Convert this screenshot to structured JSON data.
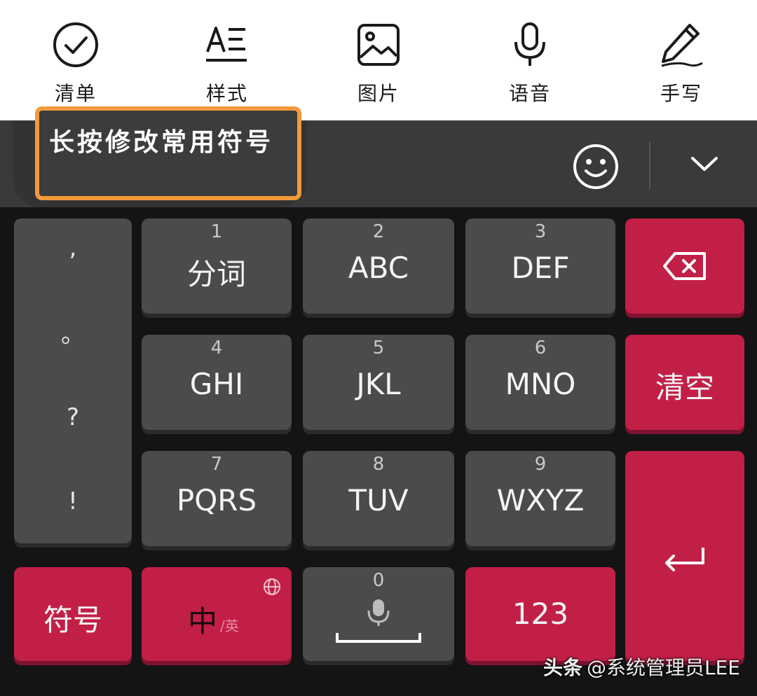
{
  "toolbar": {
    "items": [
      {
        "label": "清单",
        "icon": "checklist-circle-icon"
      },
      {
        "label": "样式",
        "icon": "text-style-icon"
      },
      {
        "label": "图片",
        "icon": "image-icon"
      },
      {
        "label": "语音",
        "icon": "microphone-icon"
      },
      {
        "label": "手写",
        "icon": "pen-icon"
      }
    ]
  },
  "candidate_bar": {
    "hint": "长按修改常用符号",
    "hint_border_color": "#f29a3c",
    "emoji_icon": "smiley-icon",
    "collapse_icon": "chevron-down-icon"
  },
  "keys": {
    "punct": [
      ",",
      "。",
      "?",
      "!"
    ],
    "k1": {
      "num": "1",
      "label": "分词"
    },
    "k2": {
      "num": "2",
      "label": "ABC"
    },
    "k3": {
      "num": "3",
      "label": "DEF"
    },
    "k4": {
      "num": "4",
      "label": "GHI"
    },
    "k5": {
      "num": "5",
      "label": "JKL"
    },
    "k6": {
      "num": "6",
      "label": "MNO"
    },
    "k7": {
      "num": "7",
      "label": "PQRS"
    },
    "k8": {
      "num": "8",
      "label": "TUV"
    },
    "k9": {
      "num": "9",
      "label": "WXYZ"
    },
    "k0": {
      "num": "0"
    },
    "backspace_icon": "backspace-icon",
    "clear": "清空",
    "enter_icon": "enter-icon",
    "symbols": "符号",
    "lang_main": "中",
    "lang_sub": "/英",
    "globe_icon": "globe-icon",
    "numbers": "123",
    "space_mic_icon": "microphone-icon"
  },
  "colors": {
    "key_gray": "#4b4b4b",
    "key_red": "#c21f47",
    "keyboard_bg": "#141414",
    "candidate_bg": "#3a3a3a"
  },
  "watermark": {
    "brand": "头条",
    "handle": "@系统管理员LEE"
  }
}
